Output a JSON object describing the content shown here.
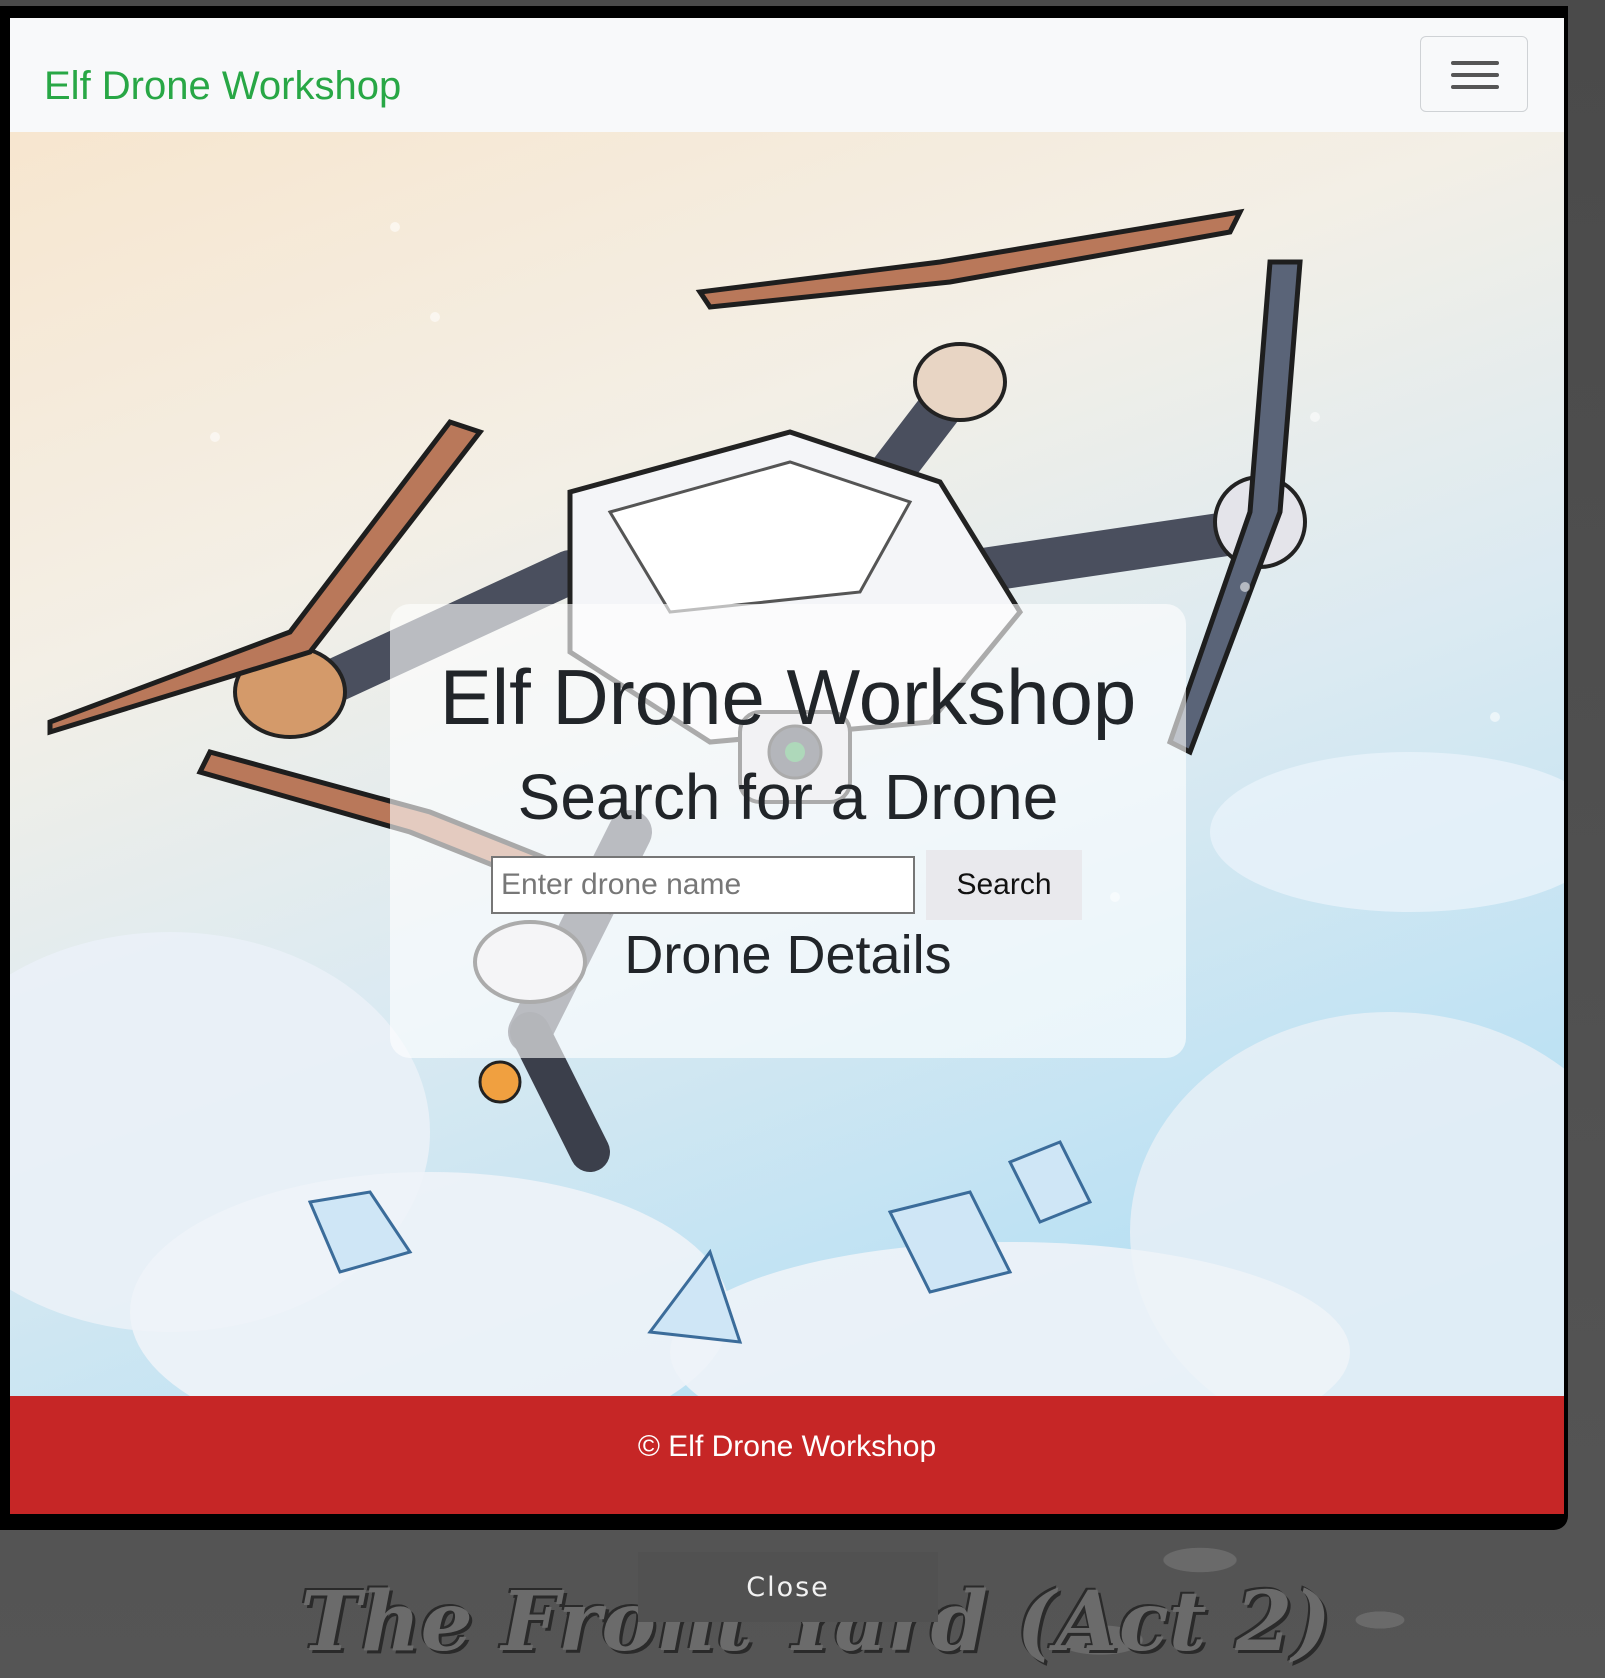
{
  "navbar": {
    "brand": "Elf Drone Workshop",
    "menu_icon": "hamburger-menu-icon"
  },
  "hero": {
    "title": "Elf Drone Workshop",
    "subtitle": "Search for a Drone",
    "search": {
      "placeholder": "Enter drone name",
      "value": "",
      "button_label": "Search"
    },
    "details_heading": "Drone Details"
  },
  "footer": {
    "text": "© Elf Drone Workshop"
  },
  "modal": {
    "close_label": "Close"
  },
  "game": {
    "area_title": "The Front Yard (Act 2)"
  },
  "colors": {
    "brand_green": "#28a745",
    "footer_red": "#c62626",
    "navbar_bg": "#f8f9fa"
  }
}
